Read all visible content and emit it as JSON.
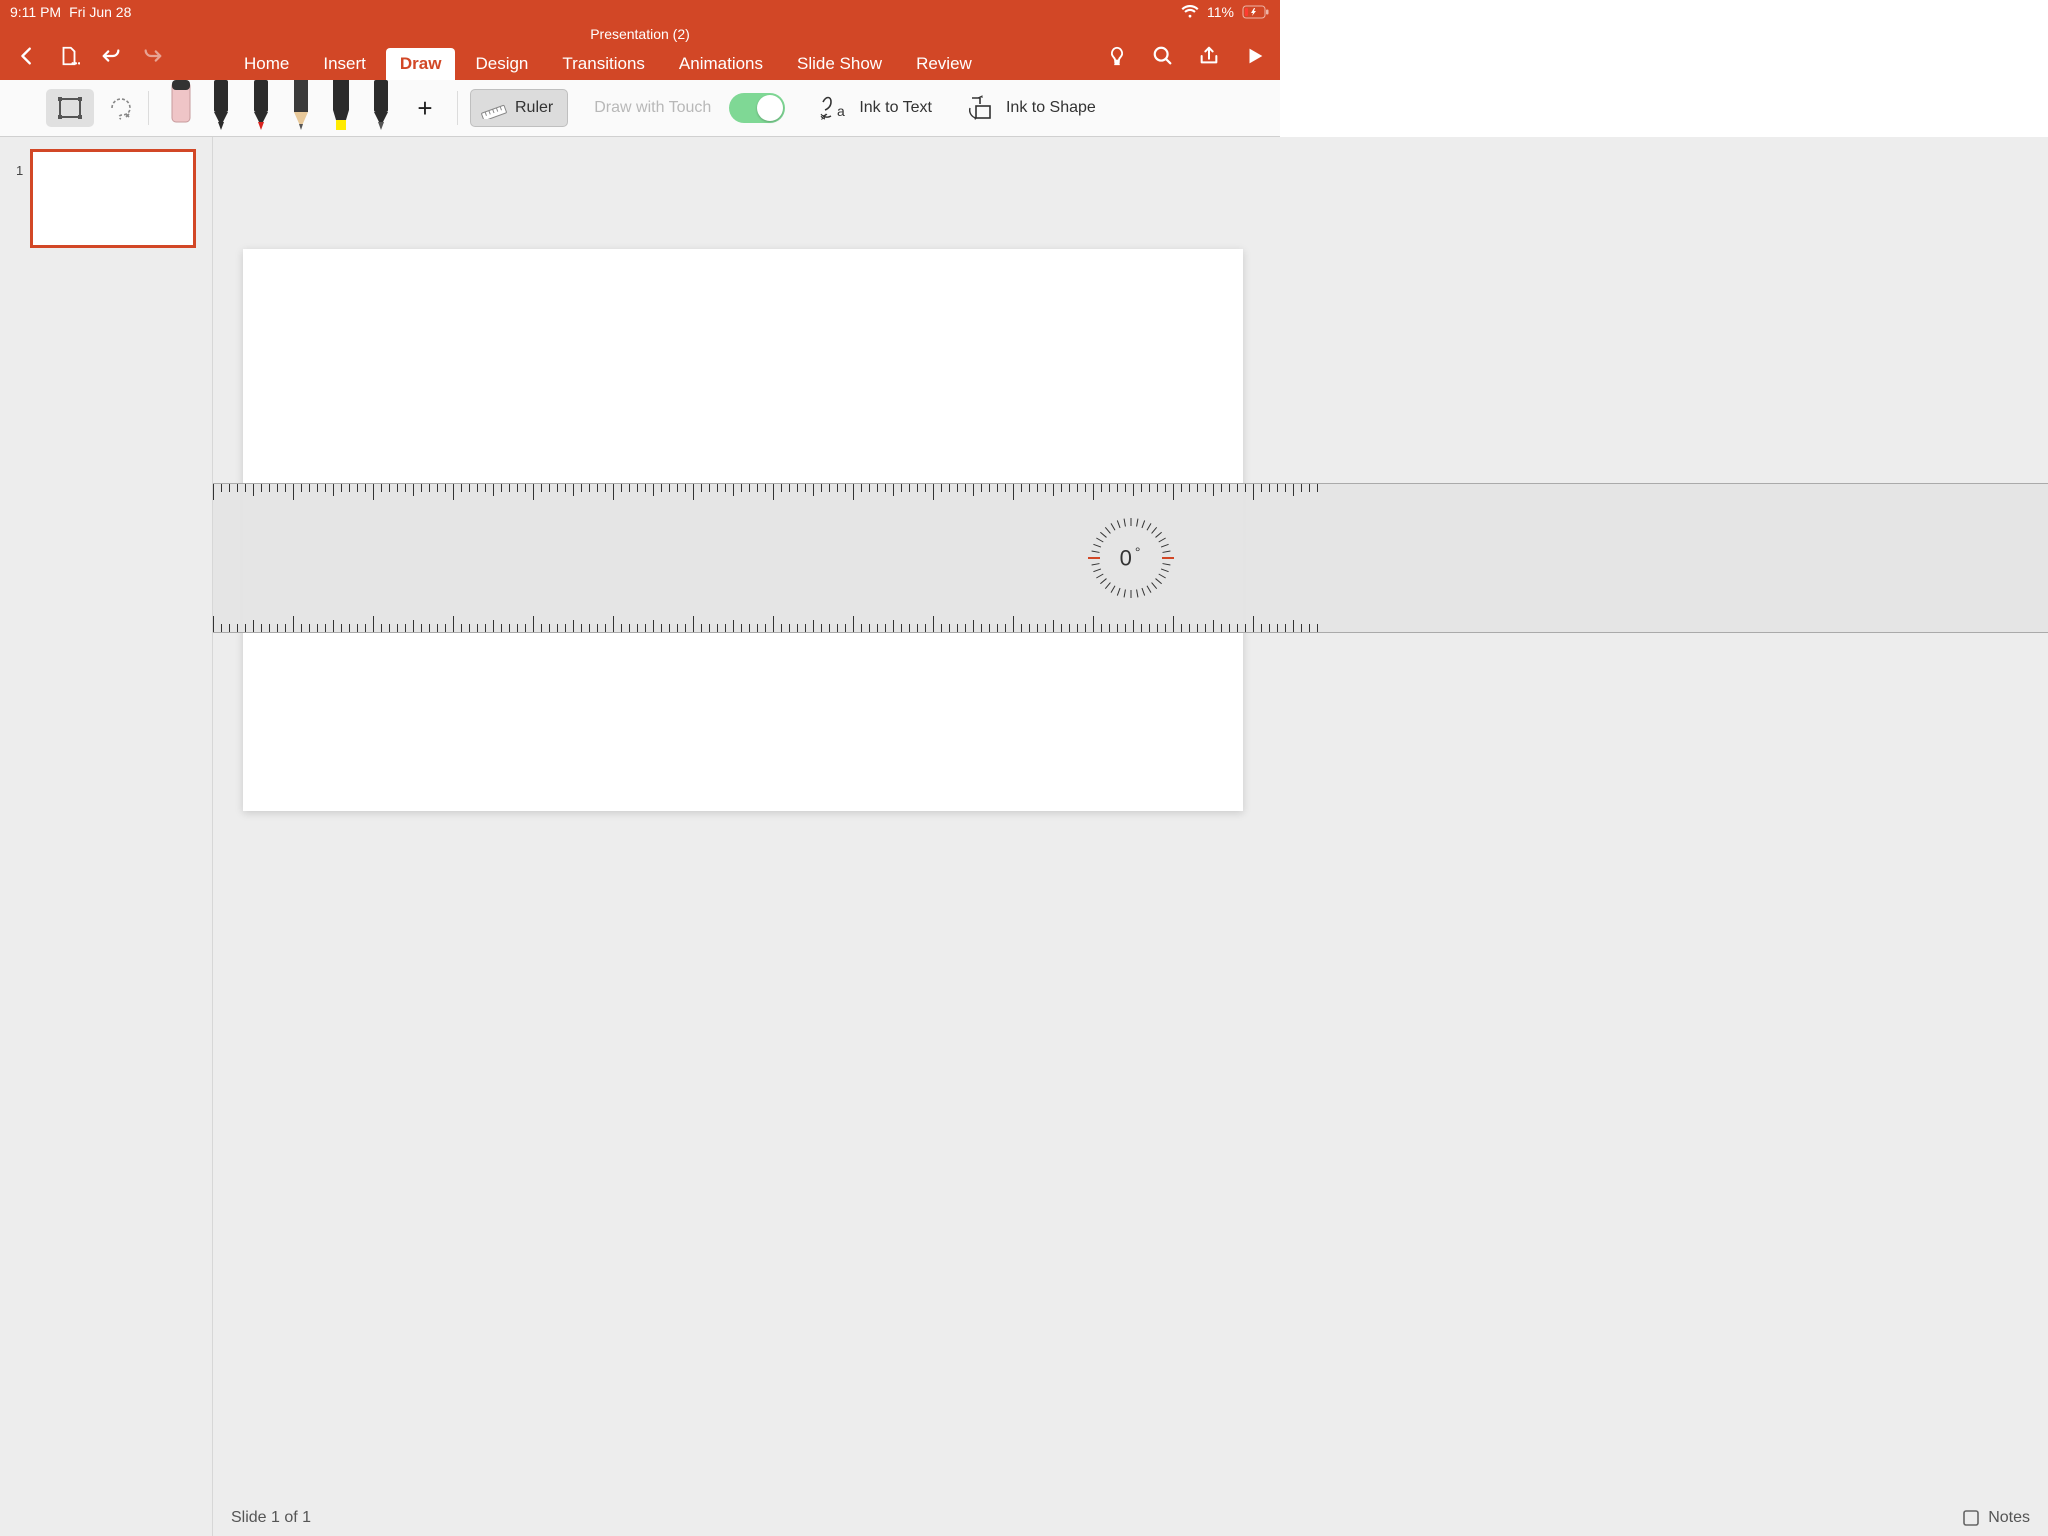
{
  "status": {
    "time": "9:11 PM",
    "date": "Fri Jun 28",
    "battery": "11%"
  },
  "doc": {
    "title": "Presentation (2)"
  },
  "tabs": [
    "Home",
    "Insert",
    "Draw",
    "Design",
    "Transitions",
    "Animations",
    "Slide Show",
    "Review"
  ],
  "active_tab": "Draw",
  "ribbon": {
    "ruler_label": "Ruler",
    "touch_label": "Draw with Touch",
    "touch_enabled": true,
    "ink_text": "Ink to Text",
    "ink_shape": "Ink to Shape",
    "pens": [
      {
        "type": "eraser",
        "color": "#efc5c7"
      },
      {
        "type": "pen",
        "color": "#2b2b2b"
      },
      {
        "type": "pen",
        "color": "#d8231f"
      },
      {
        "type": "pencil",
        "color": "#555"
      },
      {
        "type": "highlighter",
        "color": "#ffeb00"
      },
      {
        "type": "pen",
        "color": "#555"
      }
    ]
  },
  "slide_panel": {
    "current_index": "1"
  },
  "ruler": {
    "angle": "0",
    "degree_symbol": "°"
  },
  "footer": {
    "slide_status": "Slide 1 of 1",
    "notes": "Notes"
  }
}
